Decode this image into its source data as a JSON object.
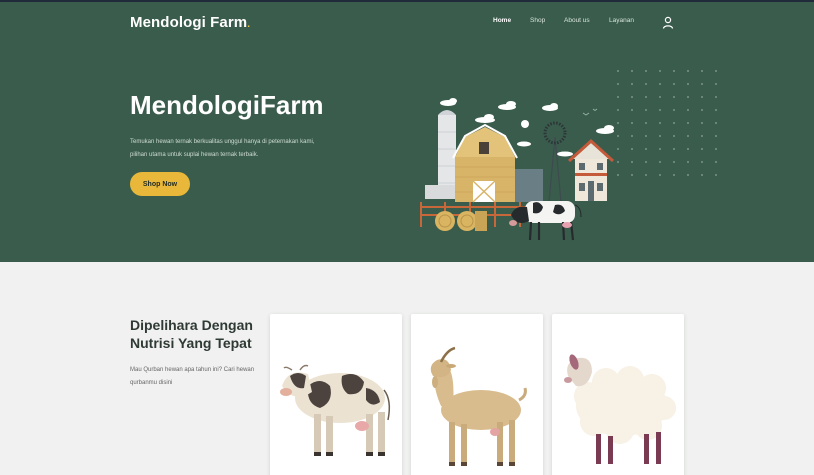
{
  "header": {
    "brand": "Mendologi Farm",
    "brand_dot": ".",
    "nav": [
      {
        "label": "Home",
        "active": true
      },
      {
        "label": "Shop",
        "active": false
      },
      {
        "label": "About us",
        "active": false
      },
      {
        "label": "Layanan",
        "active": false
      }
    ],
    "account_icon": "user-icon"
  },
  "hero": {
    "title": "MendologiFarm",
    "description": "Temukan hewan ternak berkualitas unggul hanya di peternakan kami, pilihan utama untuk suplai hewan ternak terbaik.",
    "cta_label": "Shop Now",
    "illustration": "farm-illustration-icon"
  },
  "section": {
    "title": "Dipelihara Dengan Nutrisi Yang Tepat",
    "description": "Mau Qurban hewan apa tahun ini? Cari hewan qurbanmu disini"
  },
  "cards": [
    {
      "animal": "cow-icon"
    },
    {
      "animal": "goat-icon"
    },
    {
      "animal": "sheep-icon"
    }
  ],
  "colors": {
    "hero_bg": "#3a5c4c",
    "accent": "#e9b83a",
    "page_bg": "#f0f1f0"
  }
}
